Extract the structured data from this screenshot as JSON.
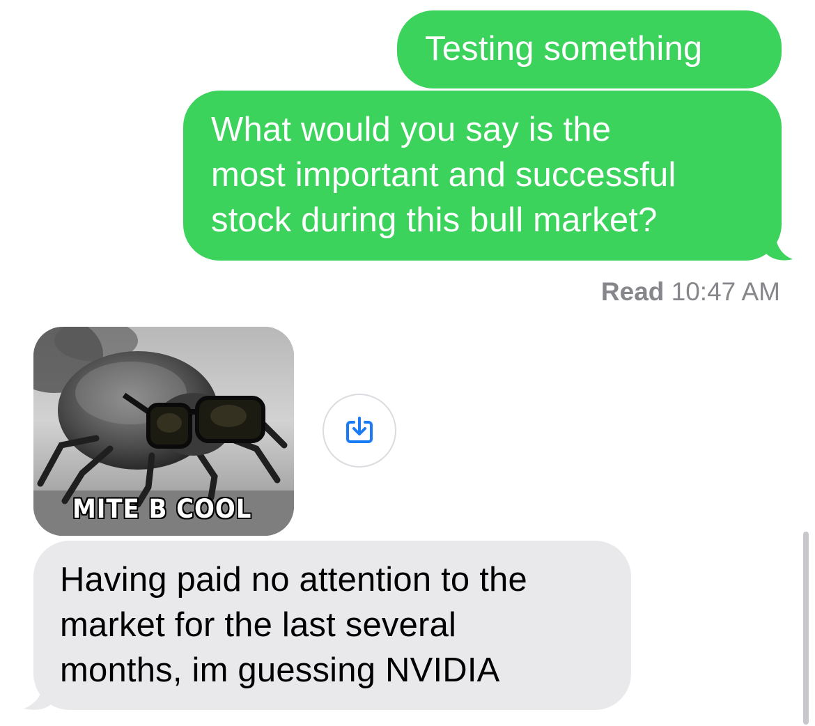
{
  "conversation": {
    "messages": [
      {
        "direction": "outgoing",
        "lines": [
          "Testing something"
        ]
      },
      {
        "direction": "outgoing",
        "lines": [
          "What would you say is the",
          "most important and successful",
          "stock during this bull market?"
        ]
      },
      {
        "direction": "incoming",
        "type": "image",
        "image_caption": "MITE B COOL",
        "image_description_icon": "mite-with-sunglasses-meme"
      },
      {
        "direction": "incoming",
        "lines": [
          "Having paid no attention to the",
          "market for the last several",
          "months, im guessing NVIDIA"
        ]
      }
    ],
    "read_receipt": {
      "label": "Read",
      "time": "10:47 AM"
    },
    "save_action_icon": "save-download-icon"
  },
  "colors": {
    "sent_bubble": "#3cd35d",
    "received_bubble": "#e9e9eb",
    "receipt_text": "#86868b",
    "accent": "#1a7cf5"
  }
}
